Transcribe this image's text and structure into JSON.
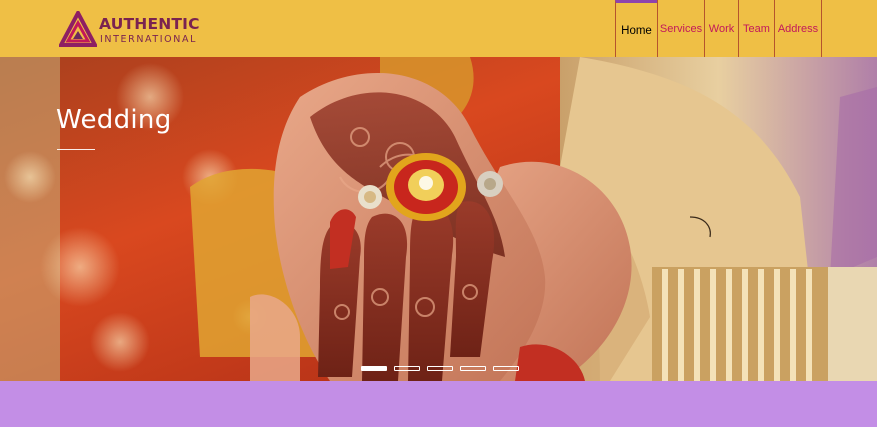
{
  "brand": {
    "name": "AUTHENTIC",
    "subtitle": "INTERNATIONAL"
  },
  "nav": {
    "items": [
      {
        "label": "Home",
        "active": true
      },
      {
        "label": "Services",
        "active": false
      },
      {
        "label": "Work",
        "active": false
      },
      {
        "label": "Team",
        "active": false
      },
      {
        "label": "Address",
        "active": false
      }
    ]
  },
  "hero": {
    "title": "Wedding",
    "slide_count": 5,
    "active_slide": 1
  },
  "colors": {
    "header_bg": "#efbf45",
    "nav_text": "#c2185b",
    "nav_active_bar": "#8e44ad",
    "footer_band": "#c38ee6",
    "logo": "#7a2350"
  }
}
